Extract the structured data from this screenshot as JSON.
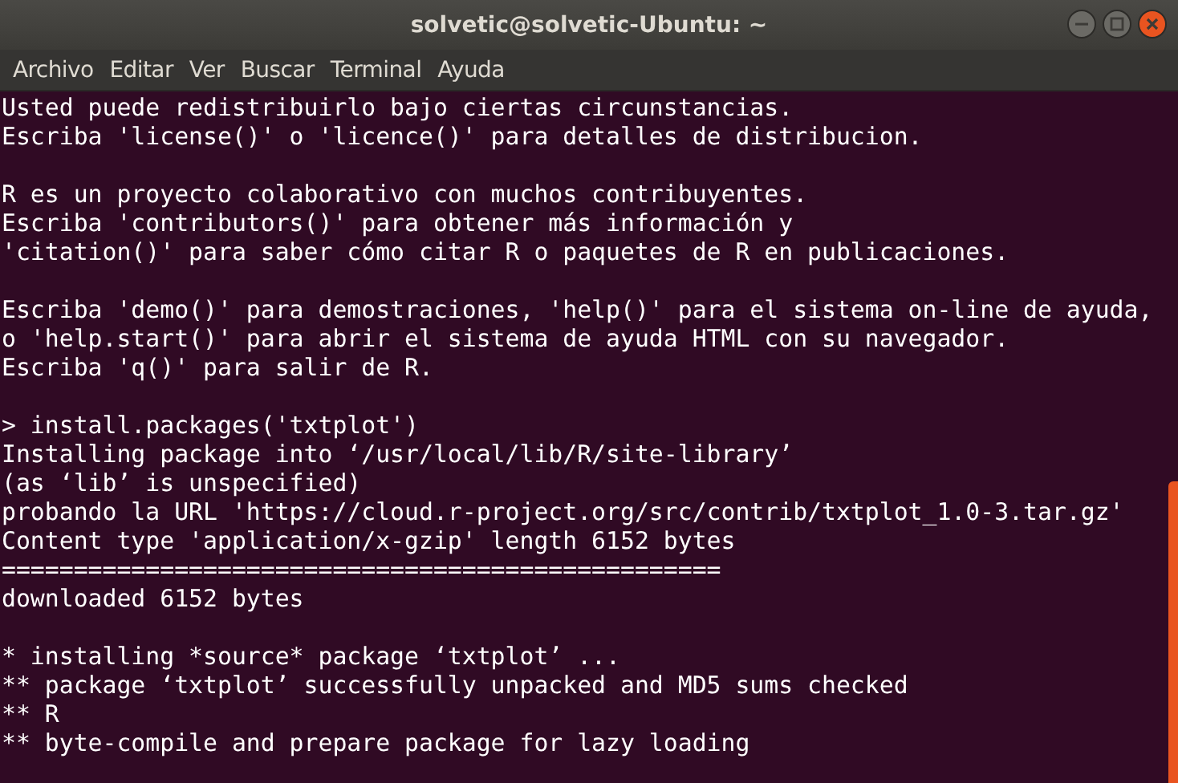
{
  "window": {
    "title": "solvetic@solvetic-Ubuntu: ~"
  },
  "menu": [
    "Archivo",
    "Editar",
    "Ver",
    "Buscar",
    "Terminal",
    "Ayuda"
  ],
  "terminal": {
    "blocks": [
      [
        "Usted puede redistribuirlo bajo ciertas circunstancias.",
        "Escriba 'license()' o 'licence()' para detalles de distribucion."
      ],
      [
        "R es un proyecto colaborativo con muchos contribuyentes.",
        "Escriba 'contributors()' para obtener más información y",
        "'citation()' para saber cómo citar R o paquetes de R en publicaciones."
      ],
      [
        "Escriba 'demo()' para demostraciones, 'help()' para el sistema on-line de ayuda,",
        "o 'help.start()' para abrir el sistema de ayuda HTML con su navegador.",
        "Escriba 'q()' para salir de R."
      ],
      [
        "> install.packages('txtplot')",
        "Installing package into ‘/usr/local/lib/R/site-library’",
        "(as ‘lib’ is unspecified)",
        "probando la URL 'https://cloud.r-project.org/src/contrib/txtplot_1.0-3.tar.gz'",
        "Content type 'application/x-gzip' length 6152 bytes",
        "==================================================",
        "downloaded 6152 bytes"
      ],
      [
        "* installing *source* package ‘txtplot’ ...",
        "** package ‘txtplot’ successfully unpacked and MD5 sums checked",
        "** R",
        "** byte-compile and prepare package for lazy loading"
      ]
    ]
  }
}
